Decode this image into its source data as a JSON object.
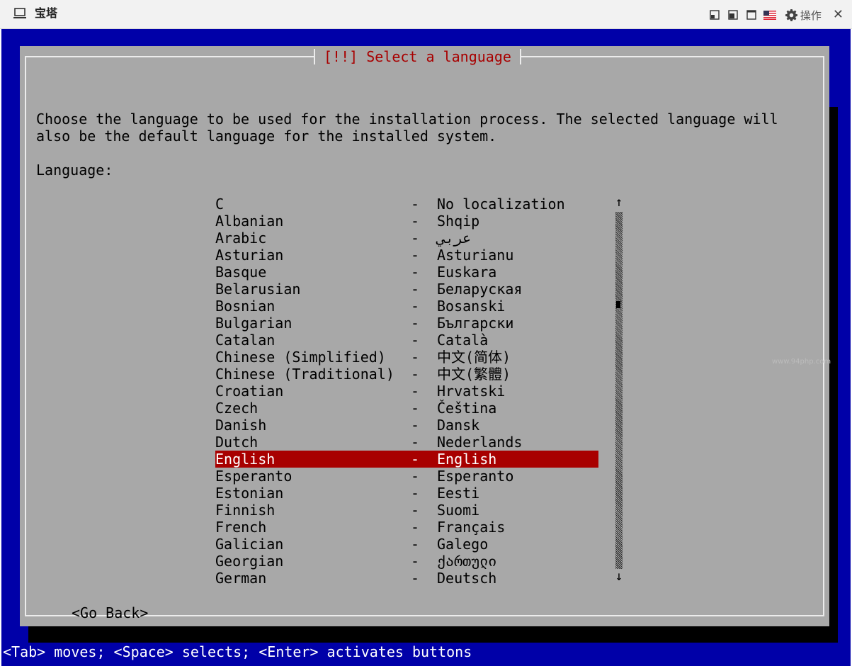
{
  "window": {
    "title": "宝塔",
    "action_label": "操作",
    "close_glyph": "✕",
    "icons": [
      "laptop-icon",
      "window-small-icon",
      "window-medium-icon",
      "window-full-icon",
      "us-flag-icon",
      "gear-icon",
      "close-icon"
    ]
  },
  "dialog": {
    "title": "[!!] Select a language",
    "description": "Choose the language to be used for the installation process. The selected language will\nalso be the default language for the installed system.",
    "field_label": "Language:",
    "selected_index": 15,
    "languages": [
      {
        "name": "C",
        "native": "No localization"
      },
      {
        "name": "Albanian",
        "native": "Shqip"
      },
      {
        "name": "Arabic",
        "native": "عربي"
      },
      {
        "name": "Asturian",
        "native": "Asturianu"
      },
      {
        "name": "Basque",
        "native": "Euskara"
      },
      {
        "name": "Belarusian",
        "native": "Беларуская"
      },
      {
        "name": "Bosnian",
        "native": "Bosanski"
      },
      {
        "name": "Bulgarian",
        "native": "Български"
      },
      {
        "name": "Catalan",
        "native": "Català"
      },
      {
        "name": "Chinese (Simplified)",
        "native": "中文(简体)"
      },
      {
        "name": "Chinese (Traditional)",
        "native": "中文(繁體)"
      },
      {
        "name": "Croatian",
        "native": "Hrvatski"
      },
      {
        "name": "Czech",
        "native": "Čeština"
      },
      {
        "name": "Danish",
        "native": "Dansk"
      },
      {
        "name": "Dutch",
        "native": "Nederlands"
      },
      {
        "name": "English",
        "native": "English"
      },
      {
        "name": "Esperanto",
        "native": "Esperanto"
      },
      {
        "name": "Estonian",
        "native": "Eesti"
      },
      {
        "name": "Finnish",
        "native": "Suomi"
      },
      {
        "name": "French",
        "native": "Français"
      },
      {
        "name": "Galician",
        "native": "Galego"
      },
      {
        "name": "Georgian",
        "native": "ქართული"
      },
      {
        "name": "German",
        "native": "Deutsch"
      }
    ],
    "separator": "-",
    "scroll_up": "↑",
    "scroll_down": "↓",
    "go_back_label": "<Go Back>"
  },
  "statusbar": {
    "text": "<Tab> moves; <Space> selects; <Enter> activates buttons"
  },
  "watermark": "www.94php.com",
  "colors": {
    "console_bg": "#0000a8",
    "dialog_bg": "#a8a8a8",
    "title_red": "#a80000",
    "selection_bg": "#a80000"
  }
}
